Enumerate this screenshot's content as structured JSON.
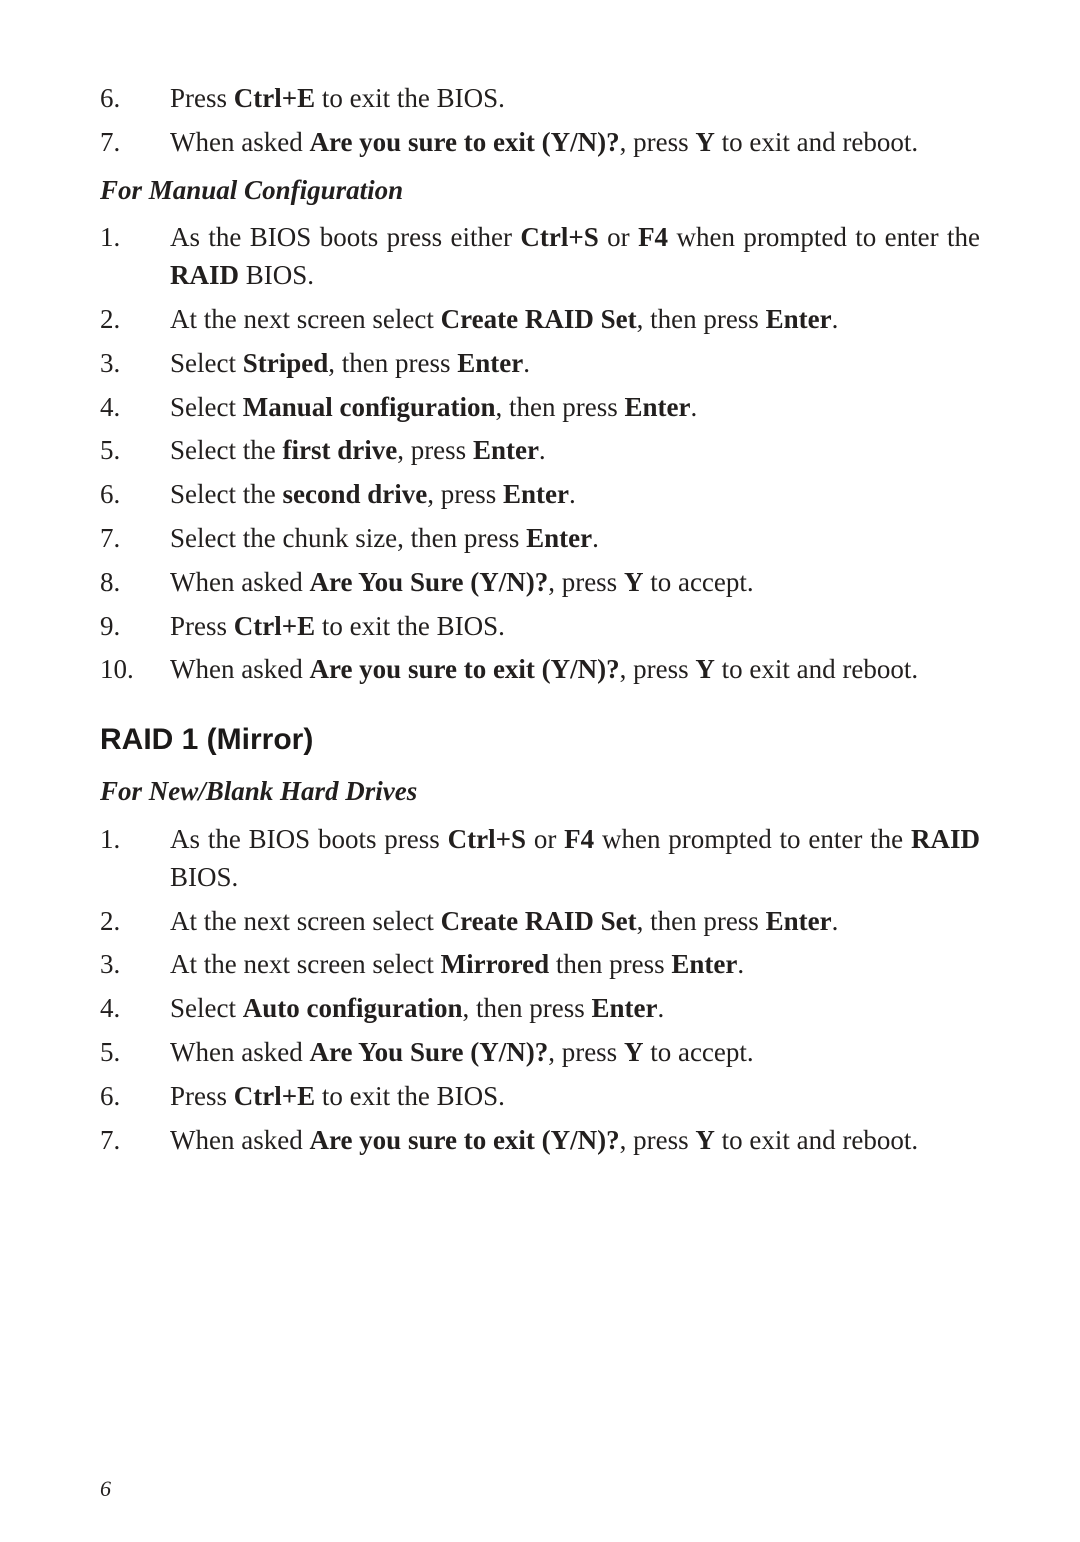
{
  "topList": {
    "items": [
      {
        "num": "6.",
        "parts": [
          "Press ",
          "Ctrl+E",
          " to exit the BIOS."
        ]
      },
      {
        "num": "7.",
        "parts": [
          "When asked ",
          "Are you sure to exit (Y/N)?",
          ", press ",
          "Y",
          " to exit and reboot."
        ]
      }
    ]
  },
  "manual": {
    "heading": "For Manual Configuration",
    "items": [
      {
        "num": "1.",
        "parts": [
          "As the BIOS boots press either ",
          "Ctrl+S",
          " or ",
          "F4",
          " when prompted to enter the ",
          "RAID",
          " BIOS."
        ]
      },
      {
        "num": "2.",
        "parts": [
          "At the next screen select ",
          "Create RAID Set",
          ", then press ",
          "Enter",
          "."
        ]
      },
      {
        "num": "3.",
        "parts": [
          "Select ",
          "Striped",
          ", then press ",
          "Enter",
          "."
        ]
      },
      {
        "num": "4.",
        "parts": [
          "Select ",
          "Manual configuration",
          ", then press ",
          "Enter",
          "."
        ]
      },
      {
        "num": "5.",
        "parts": [
          "Select the ",
          "first drive",
          ", press ",
          "Enter",
          "."
        ]
      },
      {
        "num": "6.",
        "parts": [
          "Select the ",
          "second drive",
          ", press ",
          "Enter",
          "."
        ]
      },
      {
        "num": "7.",
        "parts": [
          "Select the chunk size, then press ",
          "Enter",
          "."
        ]
      },
      {
        "num": "8.",
        "parts": [
          "When asked ",
          "Are You Sure (Y/N)?",
          ", press ",
          "Y",
          " to accept."
        ]
      },
      {
        "num": "9.",
        "parts": [
          "Press ",
          "Ctrl+E",
          " to exit the BIOS."
        ]
      },
      {
        "num": "10.",
        "parts": [
          "When asked ",
          "Are you sure to exit (Y/N)?",
          ", press ",
          "Y",
          " to exit and reboot."
        ]
      }
    ]
  },
  "raid1": {
    "heading": "RAID 1 (Mirror)",
    "subheading": "For New/Blank Hard Drives",
    "items": [
      {
        "num": "1.",
        "parts": [
          "As the BIOS boots press ",
          "Ctrl+S",
          " or ",
          "F4",
          " when prompted to enter the ",
          "RAID",
          " BIOS."
        ]
      },
      {
        "num": "2.",
        "parts": [
          "At the next screen select ",
          "Create RAID Set",
          ", then press ",
          "Enter",
          "."
        ]
      },
      {
        "num": "3.",
        "parts": [
          "At the next screen select ",
          "Mirrored",
          " then press ",
          "Enter",
          "."
        ]
      },
      {
        "num": "4.",
        "parts": [
          "Select ",
          "Auto configuration",
          ", then press ",
          "Enter",
          "."
        ]
      },
      {
        "num": "5.",
        "parts": [
          "When asked ",
          "Are You Sure (Y/N)?",
          ", press ",
          "Y",
          " to accept."
        ]
      },
      {
        "num": "6.",
        "parts": [
          "Press ",
          "Ctrl+E",
          " to exit the BIOS."
        ]
      },
      {
        "num": "7.",
        "parts": [
          "When asked ",
          "Are you sure to exit (Y/N)?",
          ", press ",
          "Y",
          " to exit and reboot."
        ]
      }
    ]
  },
  "pageNumber": "6"
}
